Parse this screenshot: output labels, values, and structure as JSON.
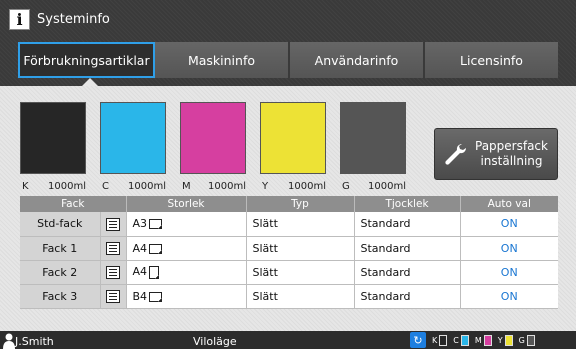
{
  "title": "Systeminfo",
  "tabs": [
    {
      "label": "Förbrukningsartiklar",
      "active": true
    },
    {
      "label": "Maskininfo",
      "active": false
    },
    {
      "label": "Användarinfo",
      "active": false
    },
    {
      "label": "Licensinfo",
      "active": false
    }
  ],
  "inks": [
    {
      "letter": "K",
      "amount": "1000ml",
      "color": "#262626"
    },
    {
      "letter": "C",
      "amount": "1000ml",
      "color": "#2ab6e9"
    },
    {
      "letter": "M",
      "amount": "1000ml",
      "color": "#d63fa0"
    },
    {
      "letter": "Y",
      "amount": "1000ml",
      "color": "#ede235"
    },
    {
      "letter": "G",
      "amount": "1000ml",
      "color": "#555555"
    }
  ],
  "paper_button": {
    "line1": "Pappersfack",
    "line2": "inställning"
  },
  "table": {
    "headers": [
      "Fack",
      "Storlek",
      "Typ",
      "Tjocklek",
      "Auto val"
    ],
    "rows": [
      {
        "tray": "Std-fack",
        "size": "A3",
        "orientation": "landscape",
        "type": "Slätt",
        "thickness": "Standard",
        "auto": "ON"
      },
      {
        "tray": "Fack 1",
        "size": "A4",
        "orientation": "landscape",
        "type": "Slätt",
        "thickness": "Standard",
        "auto": "ON"
      },
      {
        "tray": "Fack 2",
        "size": "A4",
        "orientation": "portrait",
        "type": "Slätt",
        "thickness": "Standard",
        "auto": "ON"
      },
      {
        "tray": "Fack 3",
        "size": "B4",
        "orientation": "landscape",
        "type": "Slätt",
        "thickness": "Standard",
        "auto": "ON"
      }
    ]
  },
  "status": {
    "user": "J.Smith",
    "mode": "Viloläge",
    "ink_levels": [
      {
        "letter": "K",
        "color": "#262626"
      },
      {
        "letter": "C",
        "color": "#2ab6e9"
      },
      {
        "letter": "M",
        "color": "#d63fa0"
      },
      {
        "letter": "Y",
        "color": "#ede235"
      },
      {
        "letter": "G",
        "color": "#555555"
      }
    ]
  },
  "colors": {
    "accent": "#2f9fe8",
    "auto_on": "#1976d2"
  }
}
